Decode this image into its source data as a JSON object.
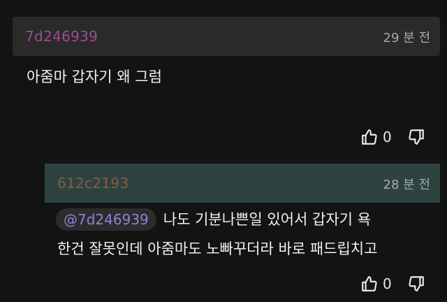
{
  "comment": {
    "author": "7d246939",
    "time": "29 분 전",
    "text": "아줌마 갑자기 왜 그럼",
    "like_count": "0"
  },
  "reply": {
    "author": "612c2193",
    "time": "28 분 전",
    "mention": "@7d246939",
    "text_line1": "나도 기분나쁜일 있어서 갑자기 욕",
    "text_line2": "한건 잘못인데 아줌마도 노빠꾸더라 바로 패드립치고",
    "like_count": "0"
  },
  "icons": {
    "like": "thumbs-up-icon",
    "dislike": "thumbs-down-icon"
  },
  "colors": {
    "background": "#131313",
    "comment_header_bg": "#2a2a2a",
    "reply_header_bg": "#2d4340",
    "comment_author": "#9a4f8e",
    "reply_author": "#8a5a45",
    "mention": "#8a86d2"
  }
}
